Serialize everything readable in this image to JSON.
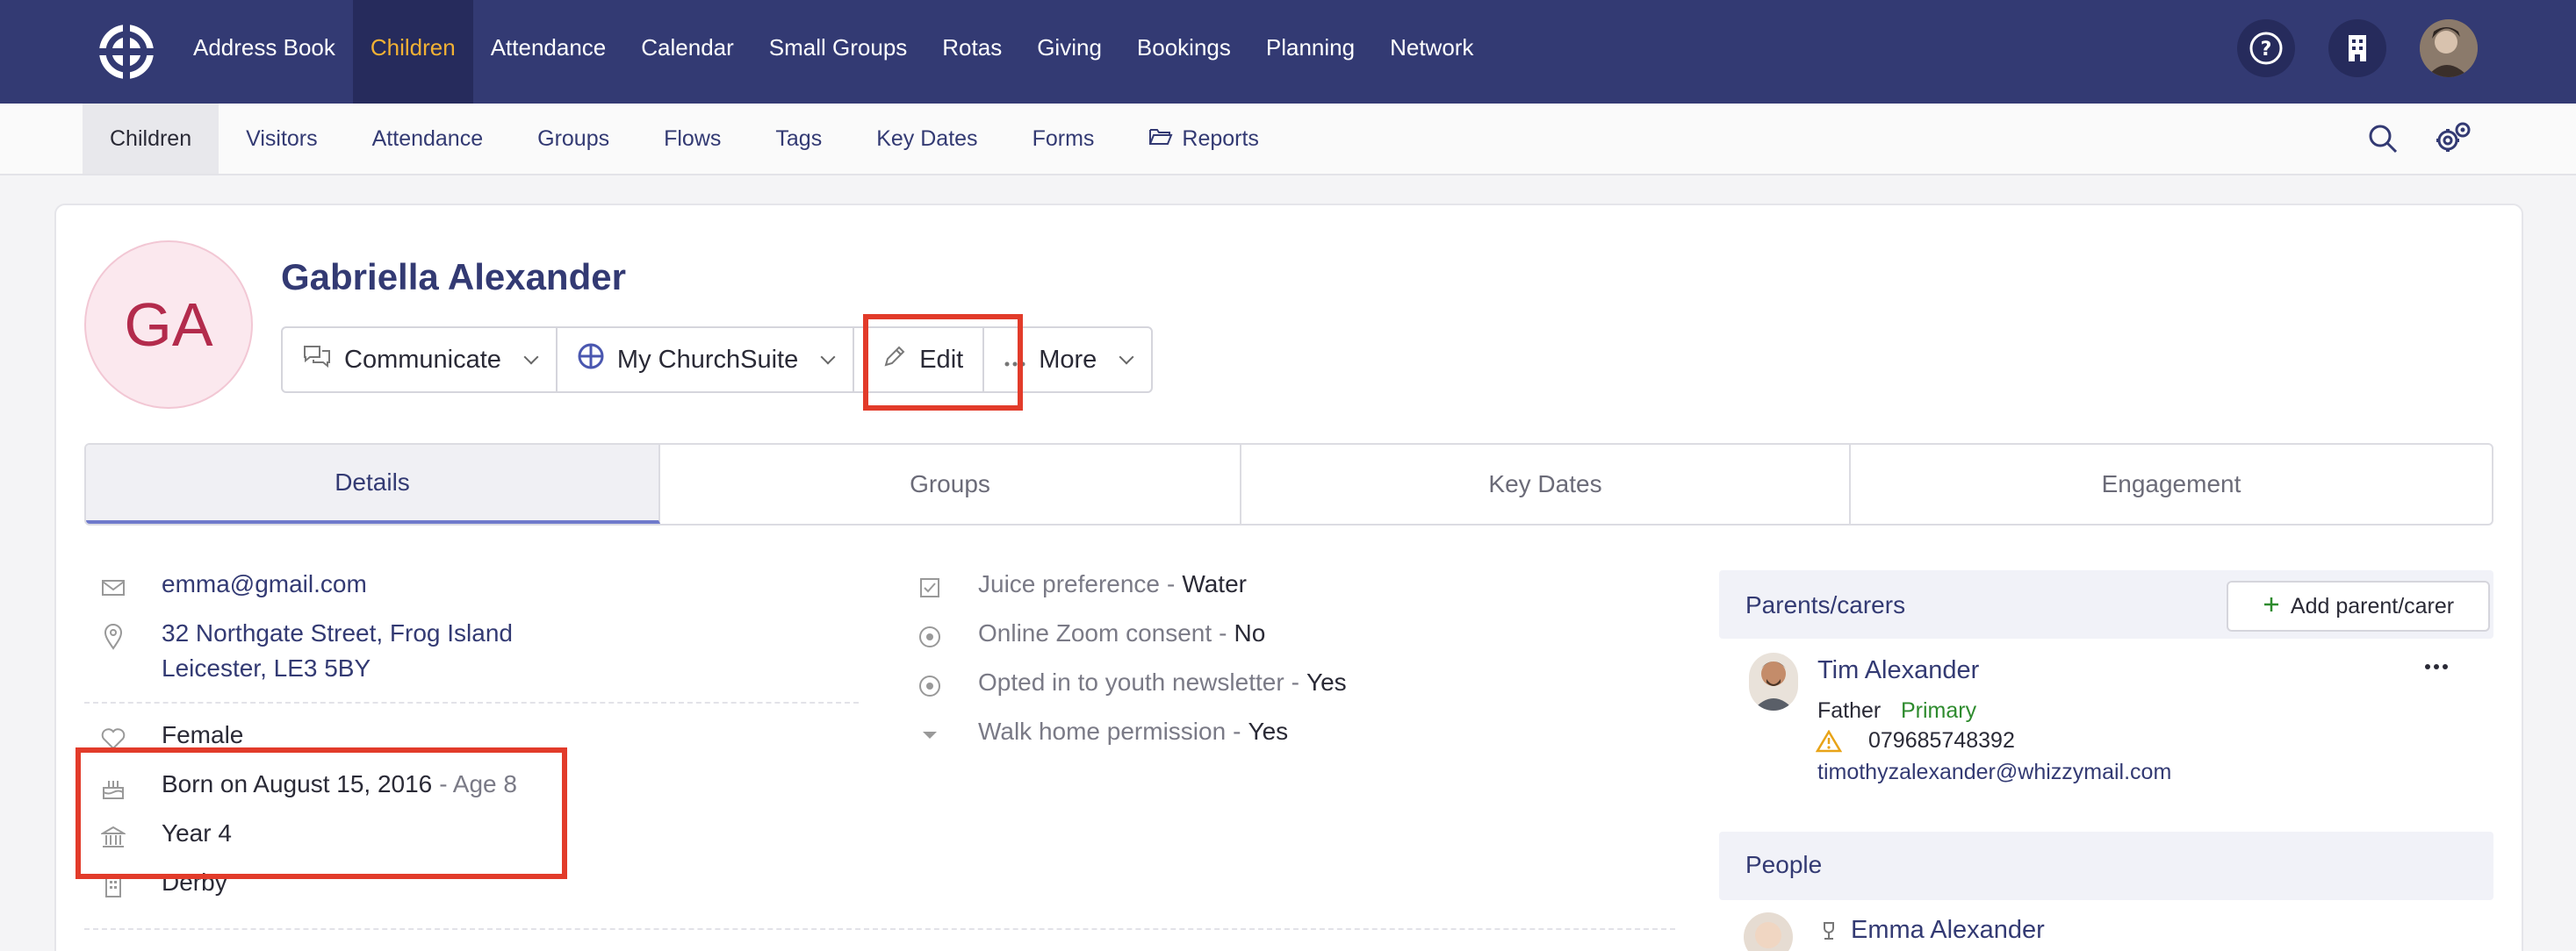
{
  "topnav": {
    "items": [
      "Address Book",
      "Children",
      "Attendance",
      "Calendar",
      "Small Groups",
      "Rotas",
      "Giving",
      "Bookings",
      "Planning",
      "Network"
    ],
    "active": "Children",
    "icons": [
      "church-logo-icon",
      "help-icon",
      "building-icon",
      "user-avatar"
    ]
  },
  "subnav": {
    "items": [
      "Children",
      "Visitors",
      "Attendance",
      "Groups",
      "Flows",
      "Tags",
      "Key Dates",
      "Forms",
      "Reports"
    ],
    "active": "Children"
  },
  "profile": {
    "initials": "GA",
    "name": "Gabriella Alexander",
    "buttons": {
      "communicate": "Communicate",
      "mychurchsuite": "My ChurchSuite",
      "edit": "Edit",
      "more": "More"
    }
  },
  "tabs": [
    "Details",
    "Groups",
    "Key Dates",
    "Engagement"
  ],
  "details": {
    "email": "emma@gmail.com",
    "address_line1": "32 Northgate Street, Frog Island",
    "address_line2": "Leicester, LE3 5BY",
    "gender": "Female",
    "born": "Born on August 15, 2016",
    "age": "- Age 8",
    "year": "Year 4",
    "site": "Derby"
  },
  "custom_fields": [
    {
      "label": "Juice preference",
      "value": "Water"
    },
    {
      "label": "Online Zoom consent",
      "value": "No"
    },
    {
      "label": "Opted in to youth newsletter",
      "value": "Yes"
    },
    {
      "label": "Walk home permission",
      "value": "Yes"
    }
  ],
  "parents": {
    "title": "Parents/carers",
    "add_label": "Add parent/carer",
    "person": {
      "name": "Tim Alexander",
      "relation": "Father",
      "primary": "Primary",
      "phone": "079685748392",
      "email": "timothyzalexander@whizzymail.com"
    }
  },
  "people": {
    "title": "People",
    "person": {
      "name": "Emma Alexander"
    }
  },
  "colors": {
    "nav_bg": "#333a73",
    "active_nav": "#f2b134",
    "highlight": "#e23b2a",
    "primary_green": "#2e8b2e",
    "warning": "#e8a317"
  }
}
